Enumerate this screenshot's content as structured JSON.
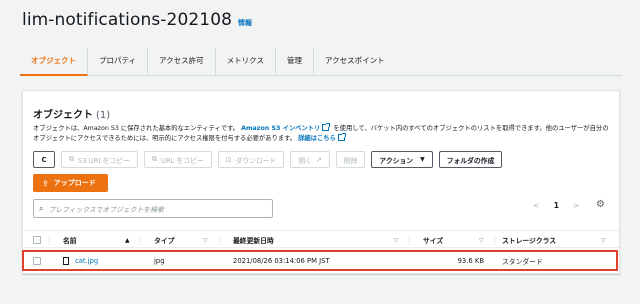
{
  "bucket": {
    "name": "lim-notifications-202108",
    "info": "情報"
  },
  "tabs": [
    {
      "label": "オブジェクト",
      "active": true
    },
    {
      "label": "プロパティ"
    },
    {
      "label": "アクセス許可"
    },
    {
      "label": "メトリクス"
    },
    {
      "label": "管理"
    },
    {
      "label": "アクセスポイント"
    }
  ],
  "objects": {
    "heading": "オブジェクト",
    "count": "(1)",
    "description": {
      "text1": "オブジェクトは、Amazon S3 に保存された基本的なエンティティです。",
      "link1": "Amazon S3 インベントリ",
      "text2": "を使用して、バケット内のすべてのオブジェクトのリストを取得できます。他のユーザーが自分のオブジェクトにアクセスできるためには、明示的にアクセス権限を付与する必要があります。",
      "link2": "詳細はこちら"
    },
    "buttons": {
      "refresh": "C",
      "copy_s3_uri": "S3 URI をコピー",
      "copy_url": "URL をコピー",
      "download": "ダウンロード",
      "open": "開く",
      "delete": "削除",
      "actions": "アクション",
      "create_folder": "フォルダの作成",
      "upload": "アップロード"
    },
    "search_placeholder": "プレフィックスでオブジェクトを検索",
    "pagination": {
      "prev": "<",
      "page": "1",
      "next": ">"
    },
    "columns": {
      "name": "名前",
      "type": "タイプ",
      "modified": "最終更新日時",
      "size": "サイズ",
      "storage_class": "ストレージクラス"
    },
    "rows": [
      {
        "name": "cat.jpg",
        "type": "jpg",
        "modified": "2021/08/26 03:14:06 PM JST",
        "size": "93.6 KB",
        "storage_class": "スタンダード"
      }
    ]
  },
  "colors": {
    "accent": "#ec7211",
    "link": "#0073bb",
    "highlight": "#e0412c"
  },
  "icons": [
    "refresh-icon",
    "copy-icon",
    "download-icon",
    "external-link-icon",
    "upload-icon",
    "search-icon",
    "gear-icon",
    "file-icon",
    "caret-down-icon",
    "sort-up-icon"
  ]
}
